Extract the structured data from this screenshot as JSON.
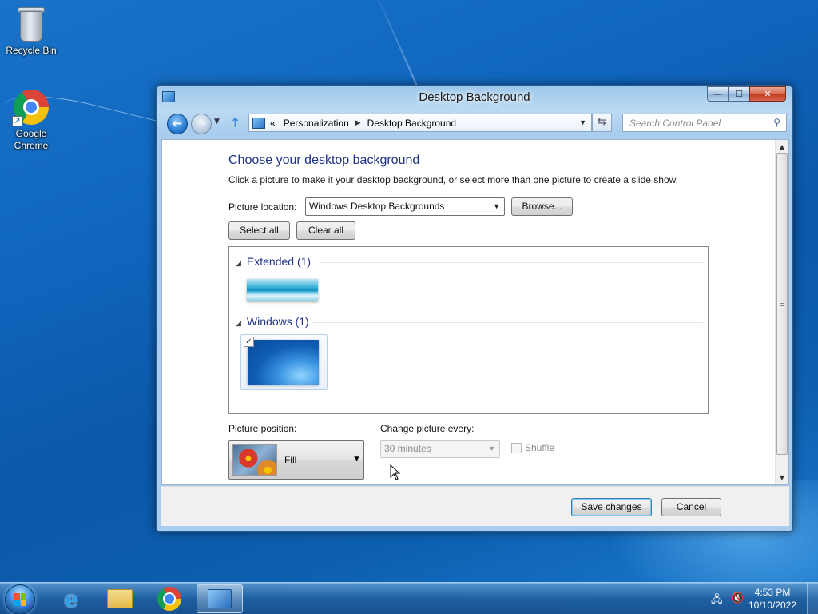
{
  "desktop": {
    "icons": [
      {
        "label": "Recycle Bin"
      },
      {
        "label": "Google Chrome"
      }
    ]
  },
  "window": {
    "title": "Desktop Background",
    "caption": {
      "min": "—",
      "max": "☐",
      "close": "✕"
    }
  },
  "nav": {
    "back_glyph": "←",
    "fwd_glyph": "→",
    "breadcrumb_prefix": "«",
    "breadcrumb": [
      "Personalization",
      "Desktop Background"
    ],
    "search_placeholder": "Search Control Panel"
  },
  "content": {
    "heading": "Choose your desktop background",
    "subtext": "Click a picture to make it your desktop background, or select more than one picture to create a slide show.",
    "picture_location_label": "Picture location:",
    "picture_location_value": "Windows Desktop Backgrounds",
    "browse_label": "Browse...",
    "select_all_label": "Select all",
    "clear_all_label": "Clear all",
    "groups": [
      {
        "name": "Extended (1)",
        "items": [
          {
            "selected": false
          }
        ]
      },
      {
        "name": "Windows (1)",
        "items": [
          {
            "selected": true
          }
        ]
      }
    ],
    "picture_position_label": "Picture position:",
    "picture_position_value": "Fill",
    "change_every_label": "Change picture every:",
    "change_every_value": "30 minutes",
    "shuffle_label": "Shuffle",
    "shuffle_checked": false
  },
  "footer": {
    "save_label": "Save changes",
    "cancel_label": "Cancel"
  },
  "taskbar": {
    "apps": [
      "internet-explorer",
      "windows-explorer",
      "google-chrome",
      "control-panel"
    ],
    "active_app": "control-panel",
    "clock_time": "4:53 PM",
    "clock_date": "10/10/2022"
  },
  "colors": {
    "heading": "#1e3287",
    "desktop": "#0b57a8"
  }
}
